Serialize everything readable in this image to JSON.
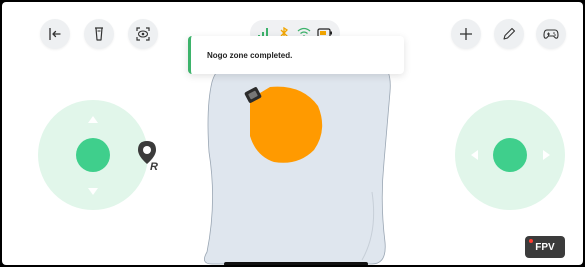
{
  "toolbar_left": {
    "exit_icon": "exit-icon",
    "device_icon": "device-icon",
    "camera_icon": "camera-eye-icon"
  },
  "status_bar": {
    "signal_icon": "signal-bars-icon",
    "bluetooth_icon": "bluetooth-icon",
    "wifi_icon": "wifi-icon",
    "battery_icon": "battery-icon"
  },
  "toolbar_right": {
    "add_icon": "plus-icon",
    "edit_icon": "pencil-icon",
    "gamepad_icon": "gamepad-icon"
  },
  "toast": {
    "message": "Nogo zone completed.",
    "accent_color": "#3db36b"
  },
  "map": {
    "zone_fill": "#dfe6ee",
    "nogo_fill": "#ff9a00",
    "marker_icon": "robot-location-r-icon",
    "marker_label": "R"
  },
  "fpv": {
    "label": "FPV"
  },
  "colors": {
    "joystick_bg": "#e1f6ea",
    "joystick_knob": "#3fcf8c"
  }
}
